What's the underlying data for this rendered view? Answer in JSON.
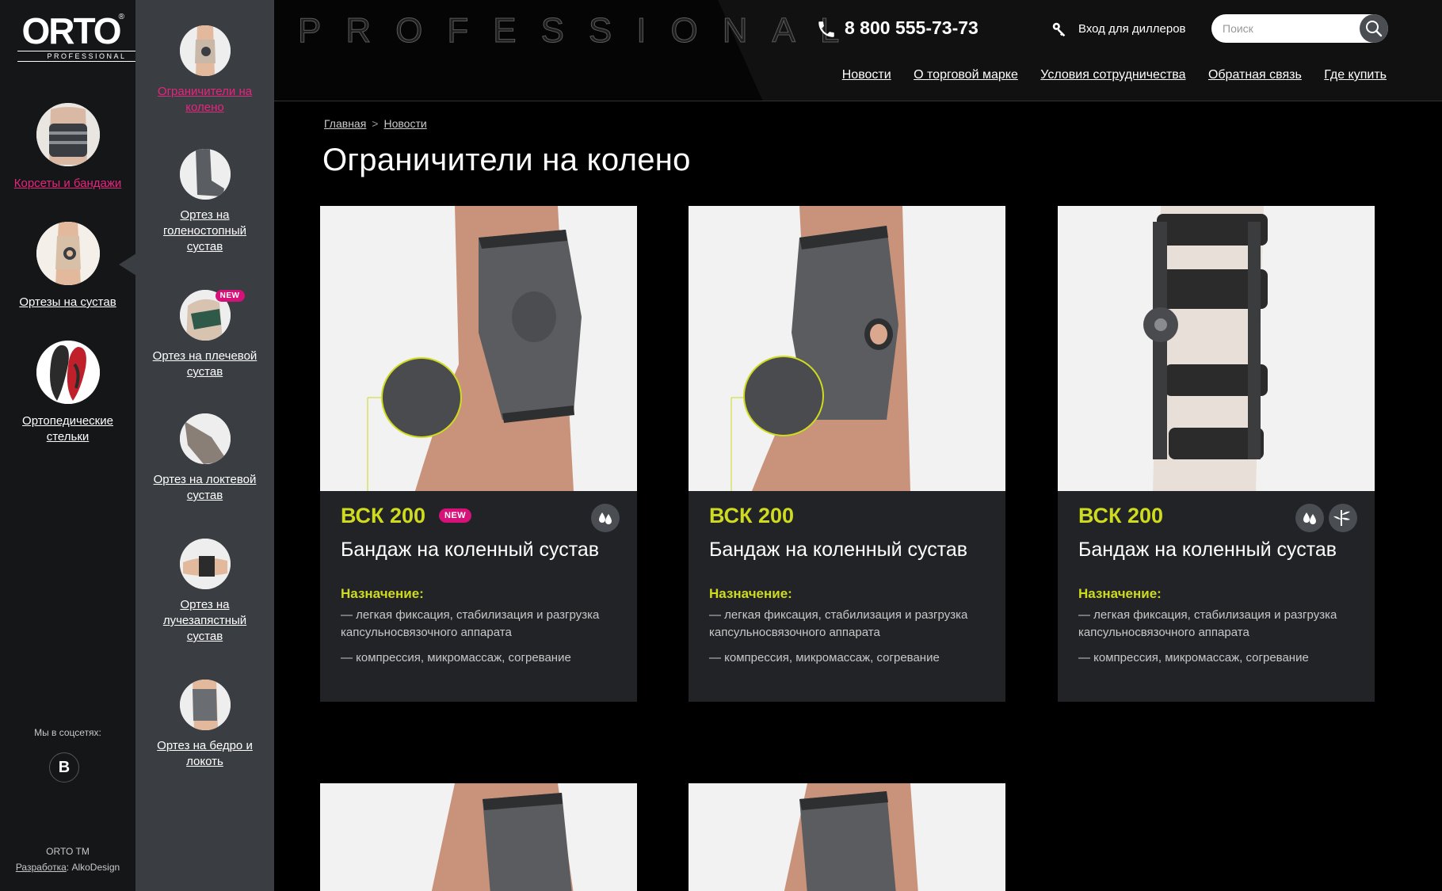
{
  "logo": {
    "mark": "ORTO",
    "registered": "®",
    "sub": "PROFESSIONAL"
  },
  "categories": [
    {
      "label": "Корсеты и бандажи"
    },
    {
      "label": "Ортезы на сустав"
    },
    {
      "label": "Ортопедические стельки"
    }
  ],
  "subcategories": [
    {
      "label": "Ограничители на колено"
    },
    {
      "label": "Ортез на голеностопный сустав"
    },
    {
      "label": "Ортез на плечевой сустав",
      "badge": "NEW"
    },
    {
      "label": "Ортез на локтевой сустав"
    },
    {
      "label": "Ортез на лучезапястный сустав"
    },
    {
      "label": "Ортез на бедро и локоть"
    }
  ],
  "social": {
    "label": "Мы в соцсетях:",
    "vk": "В"
  },
  "footer": {
    "tm": "ORTO TM",
    "dev_label": "Разработка",
    "dev_name": ": AlkoDesign"
  },
  "header": {
    "brand_word": "PROFESSIONAL",
    "phone": "8 800 555-73-73",
    "dealer_link": "Вход для диллеров",
    "search_placeholder": "Поиск",
    "nav": [
      "Новости",
      "О торговой марке",
      "Условия сотрудничества",
      "Обратная связь",
      "Где купить"
    ]
  },
  "breadcrumb": {
    "home": "Главная",
    "sep": ">",
    "current": "Новости"
  },
  "page_title": "Ограничители на колено",
  "products": [
    {
      "code": "ВСК 200",
      "badge": "NEW",
      "name": "Бандаж на коленный сустав",
      "purpose_label": "Назначение:",
      "desc1": " — легкая фиксация, стабилизация и разгрузка капсульносвязочного аппарата",
      "desc2": " — компрессия, микромассаж, согревание",
      "icons": [
        "water-drops-icon"
      ]
    },
    {
      "code": "ВСК 200",
      "name": "Бандаж на коленный сустав",
      "purpose_label": "Назначение:",
      "desc1": " — легкая фиксация, стабилизация и разгрузка капсульносвязочного аппарата",
      "desc2": " — компрессия, микромассаж, согревание",
      "icons": []
    },
    {
      "code": "ВСК 200",
      "name": "Бандаж на коленный сустав",
      "purpose_label": "Назначение:",
      "desc1": " — легкая фиксация, стабилизация и разгрузка капсульносвязочного аппарата",
      "desc2": " — компрессия, микромассаж, согревание",
      "icons": [
        "water-drops-icon",
        "bamboo-icon"
      ]
    }
  ],
  "colors": {
    "accent_pink": "#e6257e",
    "accent_yellow": "#cfdb1e",
    "card_bg": "#212326",
    "sidebar_bg": "#3a3d42"
  }
}
